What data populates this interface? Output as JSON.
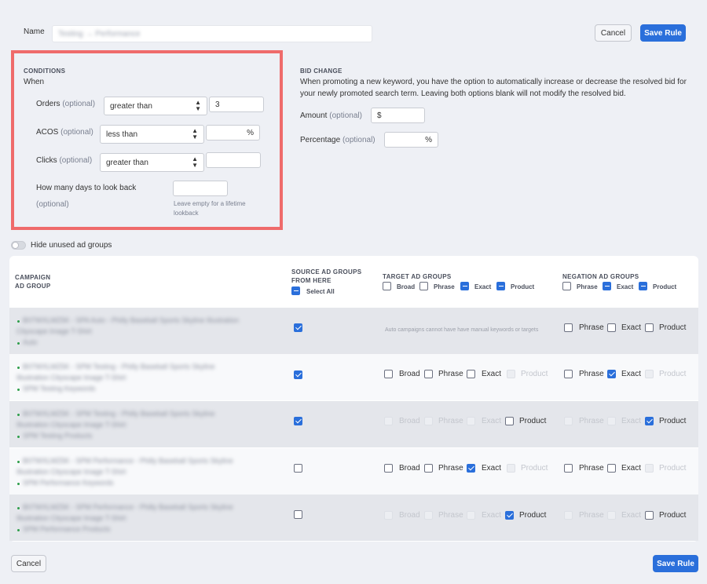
{
  "name_field": {
    "label": "Name",
    "value": "Testing → Performance"
  },
  "header_buttons": {
    "cancel": "Cancel",
    "save": "Save Rule"
  },
  "conditions": {
    "title": "CONDITIONS",
    "when": "When",
    "orders": {
      "label": "Orders",
      "optional": "(optional)",
      "operator": "greater than",
      "value": "3"
    },
    "acos": {
      "label": "ACOS",
      "optional": "(optional)",
      "operator": "less than",
      "value": "",
      "unit": "%"
    },
    "clicks": {
      "label": "Clicks",
      "optional": "(optional)",
      "operator": "greater than",
      "value": ""
    },
    "lookback": {
      "label": "How many days to look back",
      "optional": "(optional)",
      "value": "",
      "hint": "Leave empty for a lifetime lookback"
    }
  },
  "bid_change": {
    "title": "BID CHANGE",
    "description": "When promoting a new keyword, you have the option to automatically increase or decrease the resolved bid for your newly promoted search term. Leaving both options blank will not modify the resolved bid.",
    "amount": {
      "label": "Amount",
      "optional": "(optional)",
      "prefix": "$",
      "value": ""
    },
    "percentage": {
      "label": "Percentage",
      "optional": "(optional)",
      "suffix": "%",
      "value": ""
    }
  },
  "toggle": {
    "label": "Hide unused ad groups",
    "on": false
  },
  "table": {
    "headers": {
      "campaign": "CAMPAIGN",
      "ad_group": "AD GROUP",
      "source": "SOURCE AD GROUPS FROM HERE",
      "select_all": "Select All",
      "target": "TARGET AD GROUPS",
      "negation": "NEGATION AD GROUPS",
      "broad": "Broad",
      "phrase": "Phrase",
      "exact": "Exact",
      "product": "Product"
    },
    "auto_note": "Auto campaigns cannot have have manual keywords or targets",
    "rows": [
      {
        "campaign": "B07WXLMZ5K - SPA Auto - Philly Baseball Sports Skyline Illustration",
        "campaign2": "Cityscape Image T-Shirt",
        "ad_group": "Auto"
      },
      {
        "campaign": "B07WXLMZ5K - SPM Testing - Philly Baseball Sports Skyline",
        "campaign2": "Illustration Cityscape Image T-Shirt",
        "ad_group": "SPM Testing Keywords"
      },
      {
        "campaign": "B07WXLMZ5K - SPM Testing - Philly Baseball Sports Skyline",
        "campaign2": "Illustration Cityscape Image T-Shirt",
        "ad_group": "SPM Testing Products"
      },
      {
        "campaign": "B07WXLMZ5K - SPM Performance - Philly Baseball Sports Skyline",
        "campaign2": "Illustration Cityscape Image T-Shirt",
        "ad_group": "SPM Performance Keywords"
      },
      {
        "campaign": "B07WXLMZ5K - SPM Performance - Philly Baseball Sports Skyline",
        "campaign2": "Illustration Cityscape Image T-Shirt",
        "ad_group": "SPM Performance Products"
      }
    ]
  },
  "footer_buttons": {
    "cancel": "Cancel",
    "save": "Save Rule"
  },
  "colors": {
    "accent": "#2a6fdb",
    "highlight": "#ef6b6b",
    "ad_group_dot": "#2e9e4a"
  }
}
